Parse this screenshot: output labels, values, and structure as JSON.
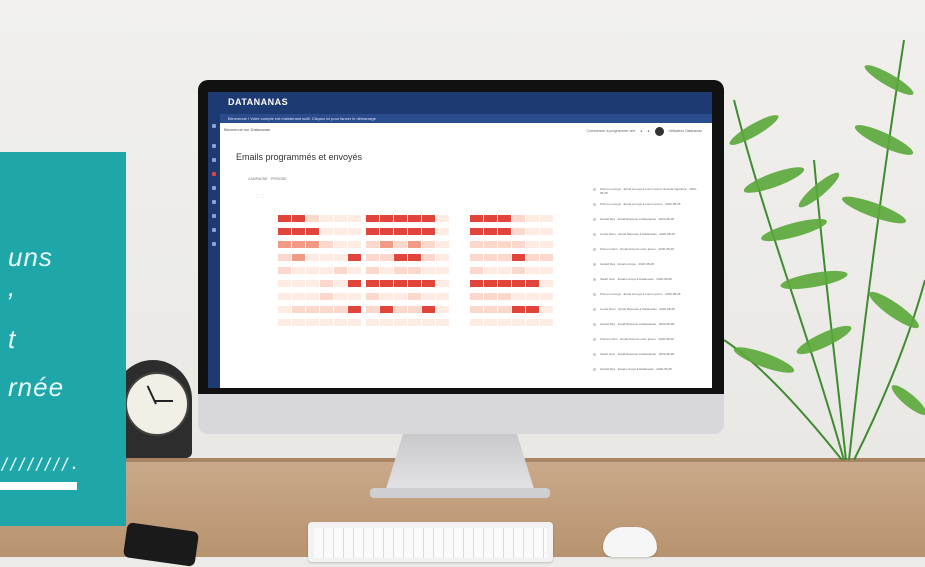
{
  "teal_panel": {
    "lines": [
      "uns",
      ",",
      "t",
      "rnée"
    ],
    "hatch": "////////."
  },
  "app": {
    "brand": "DATANANAS",
    "notice": "Bienvenue ! Votre compte est maintenant actif. Cliquez ici pour lancer le démarrage",
    "breadcrumb": "Bienvenue sur Datananas",
    "user_link": "Commencer à programmer une",
    "user_name": "Utilisateur Datananas",
    "page_title": "Emails programmés et envoyés",
    "filters": "CAMPAGNE  ·  PERIODE",
    "legend": "⬚ ⬚",
    "heatmap_label": "▪▪▪",
    "feed": [
      "Prénom envoyé · Email envoyé à Lorem ipsum Società Ingénieur · 2020-08-28",
      "Prénom envoyé · Email envoyé à Lorem ipsum · 2020-08-28",
      "Gérald Rey · Email Réponse à Datananas · 2020-08-28",
      "Lucas Roux · Email Réponse à Datananas · 2020-08-28",
      "Prénom Nom · Email Ouvert Lorem ipsum · 2020-08-28",
      "Gérald Rey · Email envoyé · 2020-08-28",
      "Sarah Nom · Email envoyé à Datananas · 2020-08-28",
      "Prénom envoyé · Email envoyé à Lorem ipsum · 2020-08-28",
      "Lucas Roux · Email Réponse à Datananas · 2020-08-28",
      "Gérald Rey · Email Réponse à Datananas · 2020-08-28",
      "Prénom Nom · Email Ouvert Lorem ipsum · 2020-08-28",
      "Sarah Nom · Email Réponse à Datananas · 2020-08-28",
      "Gérald Rey · Email envoyé à Datananas · 2020-08-28"
    ]
  },
  "colors": {
    "teal": "#1fa6a8",
    "navy": "#1d3a73",
    "heat_high": "#e0443b",
    "heat_mid": "#f19a86",
    "heat_low": "#fbd7cc",
    "heat_faint": "#fdebe4"
  },
  "icons": {
    "clock": "analog-clock",
    "plant": "fern-leaves"
  }
}
